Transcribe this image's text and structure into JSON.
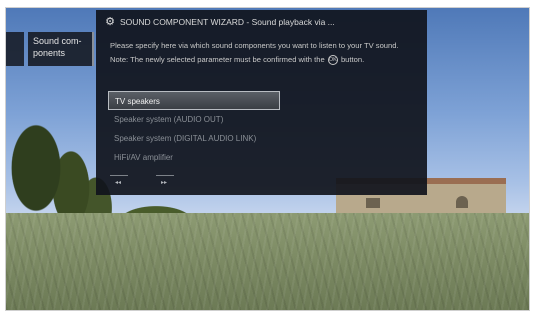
{
  "side_menu": {
    "item_label": "Sound com-\nponents"
  },
  "wizard": {
    "icon": "gear-icon",
    "title": "SOUND COMPONENT WIZARD - Sound playback via ...",
    "instruction": "Please specify here via which sound components you want to listen to your TV sound.",
    "note_before": "Note: The newly selected parameter must be confirmed with the",
    "ok_symbol": "OK",
    "note_after": "button.",
    "options": [
      {
        "label": "TV speakers",
        "selected": true
      },
      {
        "label": "Speaker system (AUDIO OUT)",
        "selected": false
      },
      {
        "label": "Speaker system (DIGITAL AUDIO LINK)",
        "selected": false
      },
      {
        "label": "HiFi/AV amplifier",
        "selected": false
      }
    ],
    "nav": {
      "back_symbol": "◂◂",
      "forward_symbol": "▸▸"
    }
  }
}
